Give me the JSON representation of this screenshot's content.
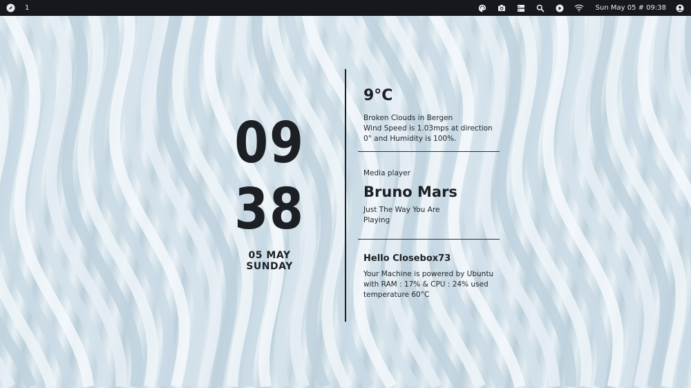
{
  "topbar": {
    "launcher_icon": "compass-icon",
    "workspace": "1",
    "tray_icons": [
      "palette-icon",
      "camera-icon",
      "storage-icon",
      "search-icon",
      "play-icon",
      "wifi-icon",
      "user-icon"
    ],
    "datetime": "Sun May 05 # 09:38"
  },
  "clock": {
    "hour": "09",
    "minute": "38",
    "date": "05 MAY",
    "weekday": "SUNDAY"
  },
  "weather": {
    "temperature": "9°C",
    "line1": "Broken Clouds in Bergen",
    "line2": "Wind Speed is 1.03mps at direction",
    "line3": "0° and Humidity is 100%."
  },
  "media": {
    "heading": "Media player",
    "artist": "Bruno Mars",
    "track": "Just The Way You Are",
    "status": "Playing"
  },
  "system": {
    "greeting": "Hello Closebox73",
    "line1": "Your Machine is powered by Ubuntu",
    "line2": "with RAM : 17% & CPU : 24% used",
    "line3": "temperature 60°C"
  },
  "colors": {
    "topbar_bg": "#15191d",
    "text_dark": "#1c1f24",
    "wallpaper_light": "#e9f1f5",
    "wallpaper_shade": "#b9cdd9"
  }
}
